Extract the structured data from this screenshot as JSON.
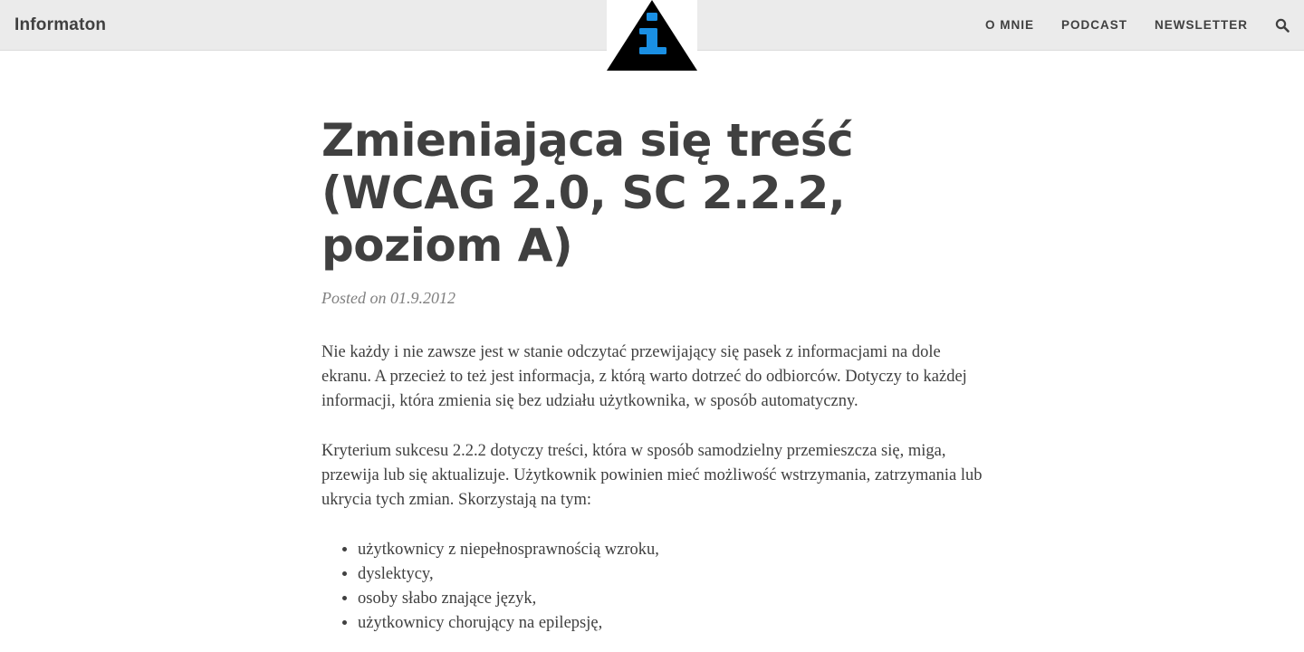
{
  "header": {
    "brand": "Informaton",
    "logo_icon": "info-triangle-icon",
    "nav": [
      {
        "label": "O MNIE"
      },
      {
        "label": "PODCAST"
      },
      {
        "label": "NEWSLETTER"
      }
    ],
    "search_icon": "search-icon"
  },
  "post": {
    "title": "Zmieniająca się treść (WCAG 2.0, SC 2.2.2, poziom A)",
    "meta": "Posted on 01.9.2012",
    "paragraphs": [
      "Nie każdy i nie zawsze jest w stanie odczytać przewijający się pasek z informacjami na dole ekranu. A przecież to też jest informacja, z którą warto dotrzeć do odbiorców. Dotyczy to każdej informacji, która zmienia się bez udziału użytkownika, w sposób automatyczny.",
      "Kryterium sukcesu 2.2.2 dotyczy treści, która w sposób samodzielny przemieszcza się, miga, przewija lub się aktualizuje. Użytkownik powinien mieć możliwość wstrzymania, zatrzymania lub ukrycia tych zmian. Skorzystają na tym:"
    ],
    "list": [
      "użytkownicy z niepełnosprawnością wzroku,",
      "dyslektycy,",
      "osoby słabo znające język,",
      "użytkownicy chorujący na epilepsję,"
    ]
  },
  "colors": {
    "topbar_bg": "#ebebeb",
    "text": "#404040",
    "meta": "#808080",
    "logo_accent": "#1a8fe3"
  }
}
